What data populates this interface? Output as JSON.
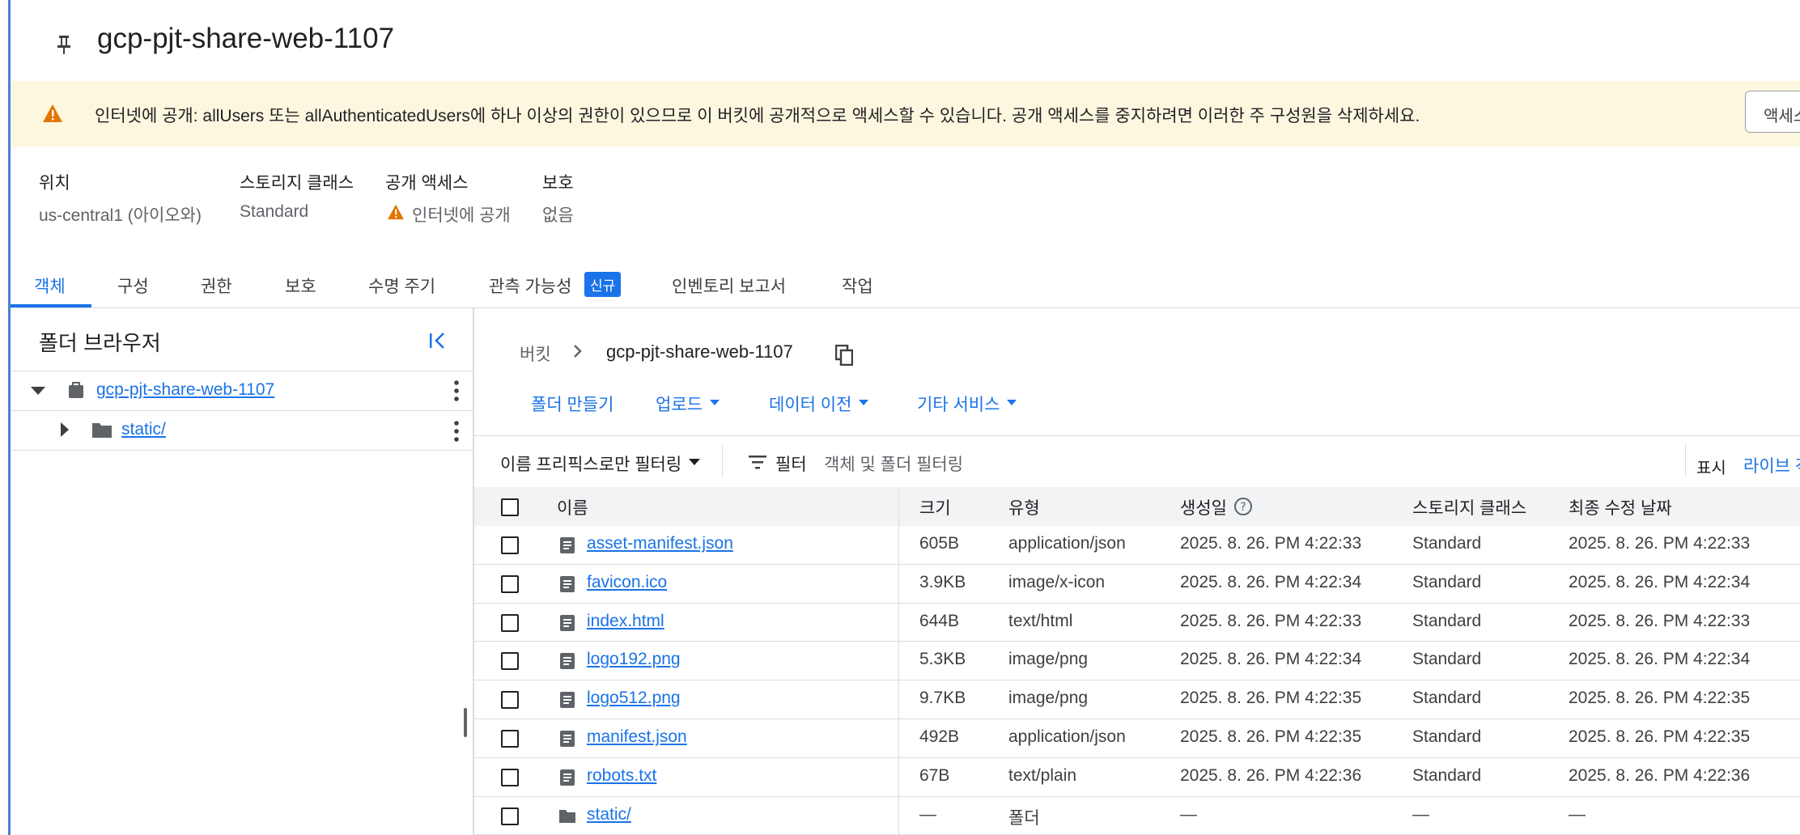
{
  "bucket": {
    "title": "gcp-pjt-share-web-1107"
  },
  "banner": {
    "text": "인터넷에 공개: allUsers 또는 allAuthenticatedUsers에 하나 이상의 권한이 있으므로 이 버킷에 공개적으로 액세스할 수 있습니다. 공개 액세스를 중지하려면 이러한 주 구성원을 삭제하세요.",
    "button": "액세스"
  },
  "info": {
    "location_label": "위치",
    "location_value": "us-central1 (아이오와)",
    "storage_class_label": "스토리지 클래스",
    "storage_class_value": "Standard",
    "public_access_label": "공개 액세스",
    "public_access_value": "인터넷에 공개",
    "protection_label": "보호",
    "protection_value": "없음"
  },
  "tabs": [
    "객체",
    "구성",
    "권한",
    "보호",
    "수명 주기",
    "관측 가능성",
    "인벤토리 보고서",
    "작업"
  ],
  "new_badge": "신규",
  "folder_browser": {
    "title": "폴더 브라우저",
    "root": "gcp-pjt-share-web-1107",
    "child": "static/"
  },
  "breadcrumb": {
    "root": "버킷",
    "current": "gcp-pjt-share-web-1107"
  },
  "actions": {
    "create_folder": "폴더 만들기",
    "upload": "업로드",
    "transfer": "데이터 이전",
    "other": "기타 서비스"
  },
  "filter": {
    "prefix": "이름 프리픽스로만 필터링",
    "label": "필터",
    "placeholder": "객체 및 폴더 필터링",
    "display_label": "표시",
    "display_value": "라이브 객"
  },
  "table": {
    "headers": [
      "이름",
      "크기",
      "유형",
      "생성일",
      "스토리지 클래스",
      "최종 수정 날짜"
    ],
    "rows": [
      {
        "name": "asset-manifest.json",
        "size": "605B",
        "type": "application/json",
        "created": "2025. 8. 26. PM 4:22:33",
        "class": "Standard",
        "modified": "2025. 8. 26. PM 4:22:33"
      },
      {
        "name": "favicon.ico",
        "size": "3.9KB",
        "type": "image/x-icon",
        "created": "2025. 8. 26. PM 4:22:34",
        "class": "Standard",
        "modified": "2025. 8. 26. PM 4:22:34"
      },
      {
        "name": "index.html",
        "size": "644B",
        "type": "text/html",
        "created": "2025. 8. 26. PM 4:22:33",
        "class": "Standard",
        "modified": "2025. 8. 26. PM 4:22:33"
      },
      {
        "name": "logo192.png",
        "size": "5.3KB",
        "type": "image/png",
        "created": "2025. 8. 26. PM 4:22:34",
        "class": "Standard",
        "modified": "2025. 8. 26. PM 4:22:34"
      },
      {
        "name": "logo512.png",
        "size": "9.7KB",
        "type": "image/png",
        "created": "2025. 8. 26. PM 4:22:35",
        "class": "Standard",
        "modified": "2025. 8. 26. PM 4:22:35"
      },
      {
        "name": "manifest.json",
        "size": "492B",
        "type": "application/json",
        "created": "2025. 8. 26. PM 4:22:35",
        "class": "Standard",
        "modified": "2025. 8. 26. PM 4:22:35"
      },
      {
        "name": "robots.txt",
        "size": "67B",
        "type": "text/plain",
        "created": "2025. 8. 26. PM 4:22:36",
        "class": "Standard",
        "modified": "2025. 8. 26. PM 4:22:36"
      },
      {
        "name": "static/",
        "size": "—",
        "type": "폴더",
        "created": "—",
        "class": "—",
        "modified": "—"
      }
    ]
  },
  "colors": {
    "accent": "#1a73e8",
    "warning": "#e37400",
    "banner_bg": "#fef7e0"
  }
}
